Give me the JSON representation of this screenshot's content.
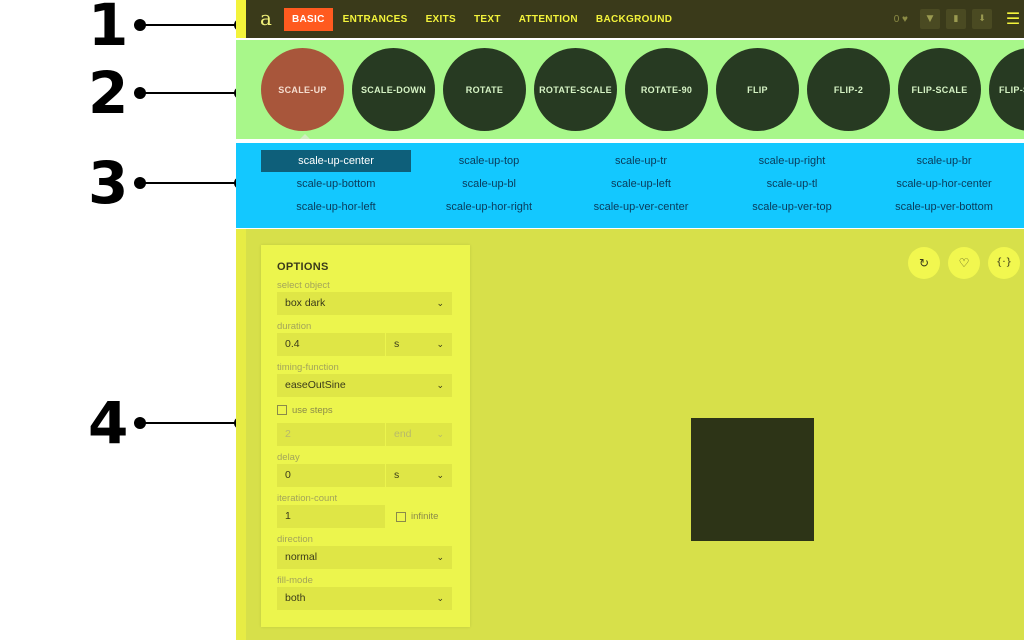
{
  "callouts": [
    "1",
    "2",
    "3",
    "4"
  ],
  "topnav": {
    "logo": "a",
    "tabs": [
      "BASIC",
      "ENTRANCES",
      "EXITS",
      "TEXT",
      "ATTENTION",
      "BACKGROUND"
    ],
    "active_tab": "BASIC",
    "favorites_count": "0",
    "icons": [
      "heart-icon",
      "filter-icon",
      "trash-icon",
      "download-icon",
      "menu-icon"
    ]
  },
  "groups": {
    "items": [
      "SCALE-UP",
      "SCALE-DOWN",
      "ROTATE",
      "ROTATE-SCALE",
      "ROTATE-90",
      "FLIP",
      "FLIP-2",
      "FLIP-SCALE",
      "FLIP-S"
    ],
    "active": "SCALE-UP"
  },
  "variants": {
    "items": [
      "scale-up-center",
      "scale-up-top",
      "scale-up-tr",
      "scale-up-right",
      "scale-up-br",
      "scale-up-bottom",
      "scale-up-bl",
      "scale-up-left",
      "scale-up-tl",
      "scale-up-hor-center",
      "scale-up-hor-left",
      "scale-up-hor-right",
      "scale-up-ver-center",
      "scale-up-ver-top",
      "scale-up-ver-bottom"
    ],
    "active": "scale-up-center"
  },
  "options": {
    "title": "OPTIONS",
    "select_object_label": "select object",
    "select_object_value": "box dark",
    "duration_label": "duration",
    "duration_value": "0.4",
    "duration_unit": "s",
    "timing_label": "timing-function",
    "timing_value": "easeOutSine",
    "use_steps_label": "use steps",
    "steps_value": "2",
    "steps_position": "end",
    "delay_label": "delay",
    "delay_value": "0",
    "delay_unit": "s",
    "iteration_label": "iteration-count",
    "iteration_value": "1",
    "infinite_label": "infinite",
    "direction_label": "direction",
    "direction_value": "normal",
    "fill_label": "fill-mode",
    "fill_value": "both"
  },
  "stage_tools": [
    "replay-icon",
    "heart-icon",
    "code-icon"
  ],
  "colors": {
    "nav_bg": "#3a3a1a",
    "nav_accent": "#f3f33b",
    "active_tab": "#ff5a1f",
    "groups_bg": "#a8f78a",
    "circle": "#273a22",
    "circle_active": "#a8563b",
    "variants_bg": "#13c8ff",
    "variant_active": "#0e5f7a",
    "stage_bg": "#d7e04a",
    "box": "#2d3417"
  }
}
